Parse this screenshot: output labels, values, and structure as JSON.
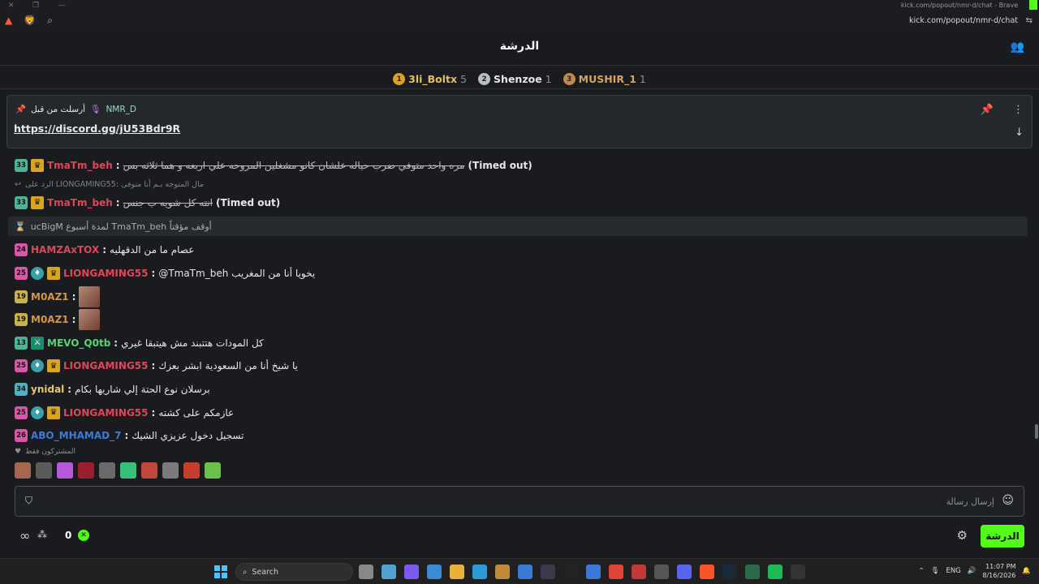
{
  "browser": {
    "title_url": "kick.com/popout/nmr-d/chat - Brave",
    "url": "kick.com/popout/nmr-d/chat"
  },
  "header": {
    "title": "الدرشة"
  },
  "leaderboard": [
    {
      "rank": "1",
      "name": "3li_Boltx",
      "count": "5",
      "rank_color": "#d9a521",
      "name_color": "#e6c15a"
    },
    {
      "rank": "2",
      "name": "Shenzoe",
      "count": "1",
      "rank_color": "#b9bec4",
      "name_color": "#e6e6e6"
    },
    {
      "rank": "3",
      "name": "MUSHIR_1",
      "count": "1",
      "rank_color": "#c08a4e",
      "name_color": "#d9a25a"
    }
  ],
  "pinned": {
    "label": "أرسلت من قبل",
    "author": "NMR_D",
    "link": "https://discord.gg/jU53Bdr9R"
  },
  "messages": [
    {
      "type": "msg",
      "level": "33",
      "level_color": "#4fb39a",
      "badges": [
        "crown"
      ],
      "username": "TmaTm_beh",
      "user_color": "#e0455a",
      "text": "مره واحد متوفي ضرب حياله علشان كانو مشغلين المروحه علي اربعه و هما ثلاثه بس",
      "struck": true,
      "suffix": "(Timed out)"
    },
    {
      "type": "reply",
      "text": "الرد على LIONGAMING55: مال المتوجه بـم أنا متوفى"
    },
    {
      "type": "msg",
      "level": "33",
      "level_color": "#4fb39a",
      "badges": [
        "crown"
      ],
      "username": "TmaTm_beh",
      "user_color": "#e0455a",
      "text": "انته كل شويه ب جنس",
      "struck": true,
      "suffix": "(Timed out)"
    },
    {
      "type": "system",
      "text": "ucBigM لمدة أسبوع TmaTm_beh أوقف مؤقتاً"
    },
    {
      "type": "msg",
      "level": "24",
      "level_color": "#d857a8",
      "badges": [],
      "username": "HAMZAxTOX",
      "user_color": "#e0455a",
      "text": "عصام ما من الدقهليه",
      "struck": false,
      "suffix": ""
    },
    {
      "type": "msg",
      "level": "25",
      "level_color": "#d857a8",
      "badges": [
        "gift",
        "crown"
      ],
      "username": "LIONGAMING55",
      "user_color": "#e0455a",
      "text": "@TmaTm_beh يخويا أنا من المغريب",
      "struck": false,
      "suffix": ""
    },
    {
      "type": "emote",
      "level": "19",
      "level_color": "#c9b24a",
      "badges": [],
      "username": "M0AZ1",
      "user_color": "#d8963d"
    },
    {
      "type": "emote",
      "level": "19",
      "level_color": "#c9b24a",
      "badges": [],
      "username": "M0AZ1",
      "user_color": "#d8963d"
    },
    {
      "type": "msg",
      "level": "13",
      "level_color": "#4fb39a",
      "badges": [
        "mod"
      ],
      "username": "MEVO_Q0tb",
      "user_color": "#5ad17a",
      "text": "كل المودات هتتبند مش هيتبقا غيري",
      "struck": false,
      "suffix": ""
    },
    {
      "type": "msg",
      "level": "25",
      "level_color": "#d857a8",
      "badges": [
        "gift",
        "crown"
      ],
      "username": "LIONGAMING55",
      "user_color": "#e0455a",
      "text": "يا شيخ أنا من السعودية ابشر بعزك",
      "struck": false,
      "suffix": ""
    },
    {
      "type": "msg",
      "level": "34",
      "level_color": "#4fb3c6",
      "badges": [],
      "username": "ynidal",
      "user_color": "#e8c86a",
      "text": "برسلان نوع الحتة إلي شاريها بكام",
      "struck": false,
      "suffix": ""
    },
    {
      "type": "msg",
      "level": "25",
      "level_color": "#d857a8",
      "badges": [
        "gift",
        "crown"
      ],
      "username": "LIONGAMING55",
      "user_color": "#e0455a",
      "text": "عازمكم على كشته",
      "struck": false,
      "suffix": ""
    },
    {
      "type": "msg",
      "level": "26",
      "level_color": "#d857a8",
      "badges": [],
      "username": "ABO_MHAMAD_7",
      "user_color": "#3d7bd6",
      "text": "تسجيل دخول عزيزي الشيك",
      "struck": false,
      "suffix": ""
    }
  ],
  "subscribers_only": "المشتركون فقط",
  "input": {
    "placeholder": "إرسال رسالة"
  },
  "bottom": {
    "points": "0",
    "chat_button": "الدرشة"
  },
  "taskbar": {
    "search_label": "Search",
    "lang": "ENG",
    "time": "11:07 PM",
    "date": "8/16/2026"
  },
  "colors": {
    "kick_green": "#53fc18",
    "background": "#191b1f"
  }
}
